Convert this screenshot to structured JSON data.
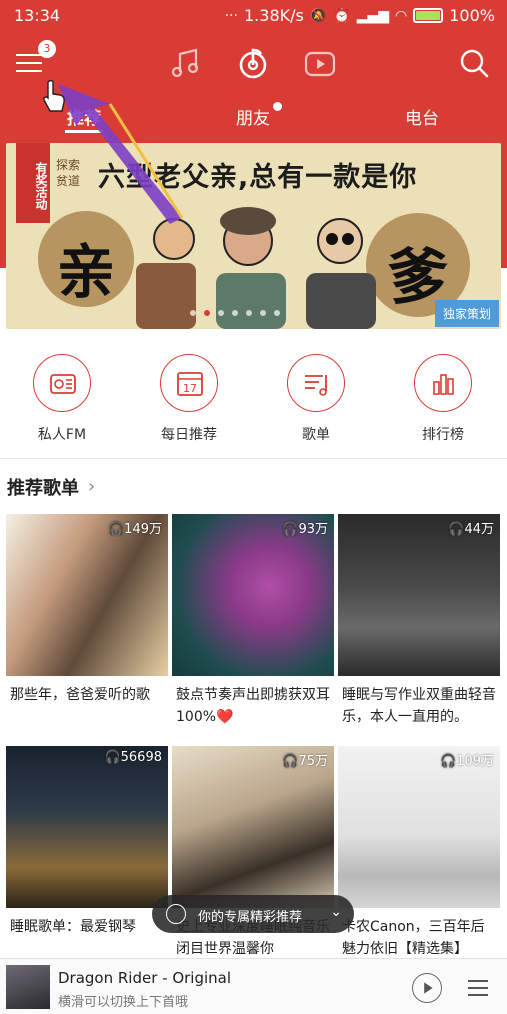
{
  "status_bar": {
    "time": "13:34",
    "network_speed": "1.38K/s",
    "battery": "100%"
  },
  "header": {
    "menu_badge": "3",
    "tabs": [
      {
        "label": "推荐",
        "active": true
      },
      {
        "label": "朋友",
        "active": false,
        "has_dot": true
      },
      {
        "label": "电台",
        "active": false
      }
    ]
  },
  "banner": {
    "ribbon": "有奖活动",
    "sub_label": "探索贫道",
    "headline": "六型老父亲,总有一款是你",
    "left_char": "亲",
    "right_char": "爹",
    "tag": "独家策划"
  },
  "quick_actions": [
    {
      "label": "私人FM",
      "icon": "radio-icon"
    },
    {
      "label": "每日推荐",
      "icon": "calendar-icon",
      "icon_text": "17"
    },
    {
      "label": "歌单",
      "icon": "playlist-icon"
    },
    {
      "label": "排行榜",
      "icon": "chart-icon"
    }
  ],
  "section": {
    "title": "推荐歌单",
    "playlists": [
      {
        "plays": "149万",
        "title": "那些年，爸爸爱听的歌"
      },
      {
        "plays": "93万",
        "title": "鼓点节奏声出即掳获双耳100%❤️"
      },
      {
        "plays": "44万",
        "title": "睡眠与写作业双重曲轻音乐，本人一直用的。"
      },
      {
        "plays": "56698",
        "title": "睡眠歌单：最爱钢琴"
      },
      {
        "plays": "75万",
        "title": "史上专业深度睡眠纯音乐 闭目世界温馨你"
      },
      {
        "plays": "109万",
        "title": "卡农Canon，三百年后魅力依旧【精选集】"
      }
    ]
  },
  "toast": {
    "text": "你的专属精彩推荐"
  },
  "player": {
    "song": "Dragon Rider - Original",
    "hint": "横滑可以切换上下首哦"
  },
  "colors": {
    "brand_red": "#d93c34"
  }
}
